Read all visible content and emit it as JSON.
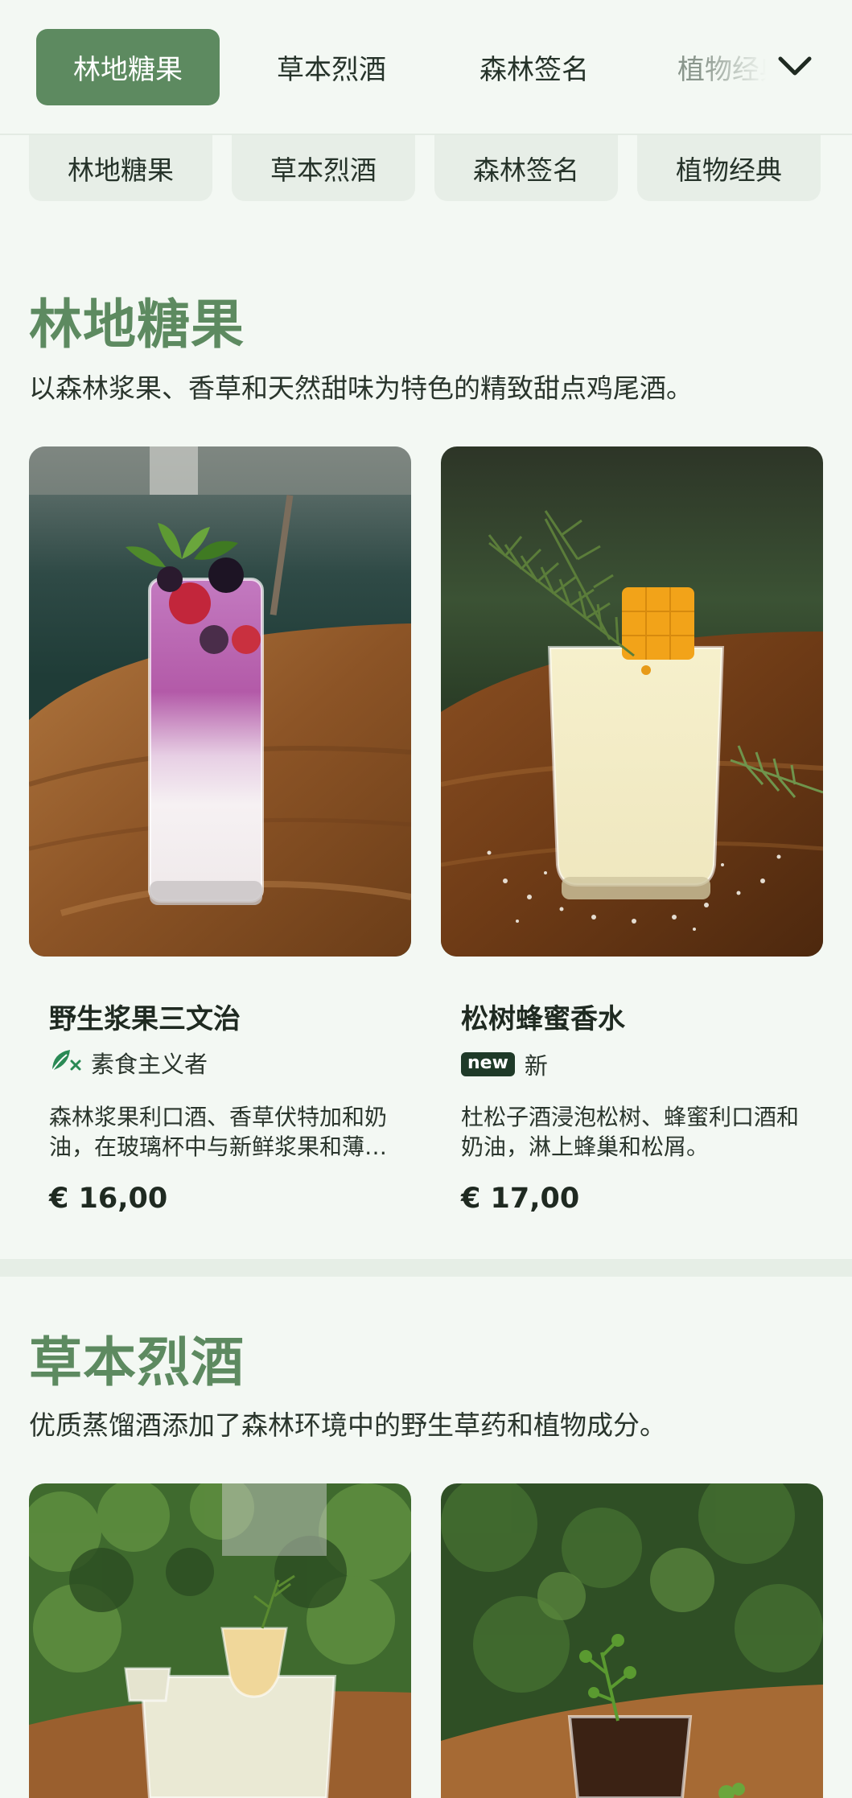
{
  "topbar": {
    "tabs": [
      {
        "label": "林地糖果",
        "active": true
      },
      {
        "label": "草本烈酒",
        "active": false
      },
      {
        "label": "森林签名",
        "active": false
      },
      {
        "label": "植物经典",
        "active": false
      }
    ],
    "expand_icon": "chevron-down-icon",
    "accent_color": "#5d8a60"
  },
  "chips": [
    "林地糖果",
    "草本烈酒",
    "森林签名",
    "植物经典"
  ],
  "sections": [
    {
      "title": "林地糖果",
      "description": "以森林浆果、香草和天然甜味为特色的精致甜点鸡尾酒。",
      "items": [
        {
          "name": "野生浆果三文治",
          "tag": "素食主义者",
          "tag_icon": "vegan-leaf-icon",
          "description": "森林浆果利口酒、香草伏特加和奶油，在玻璃杯中与新鲜浆果和薄荷叶一起分层。",
          "price": "€ 16,00"
        },
        {
          "name": "松树蜂蜜香水",
          "tag_badge": "new",
          "tag": "新",
          "description": "杜松子酒浸泡松树、蜂蜜利口酒和奶油，淋上蜂巢和松屑。",
          "price": "€ 17,00"
        }
      ]
    },
    {
      "title": "草本烈酒",
      "description": "优质蒸馏酒添加了森林环境中的野生草药和植物成分。"
    }
  ]
}
